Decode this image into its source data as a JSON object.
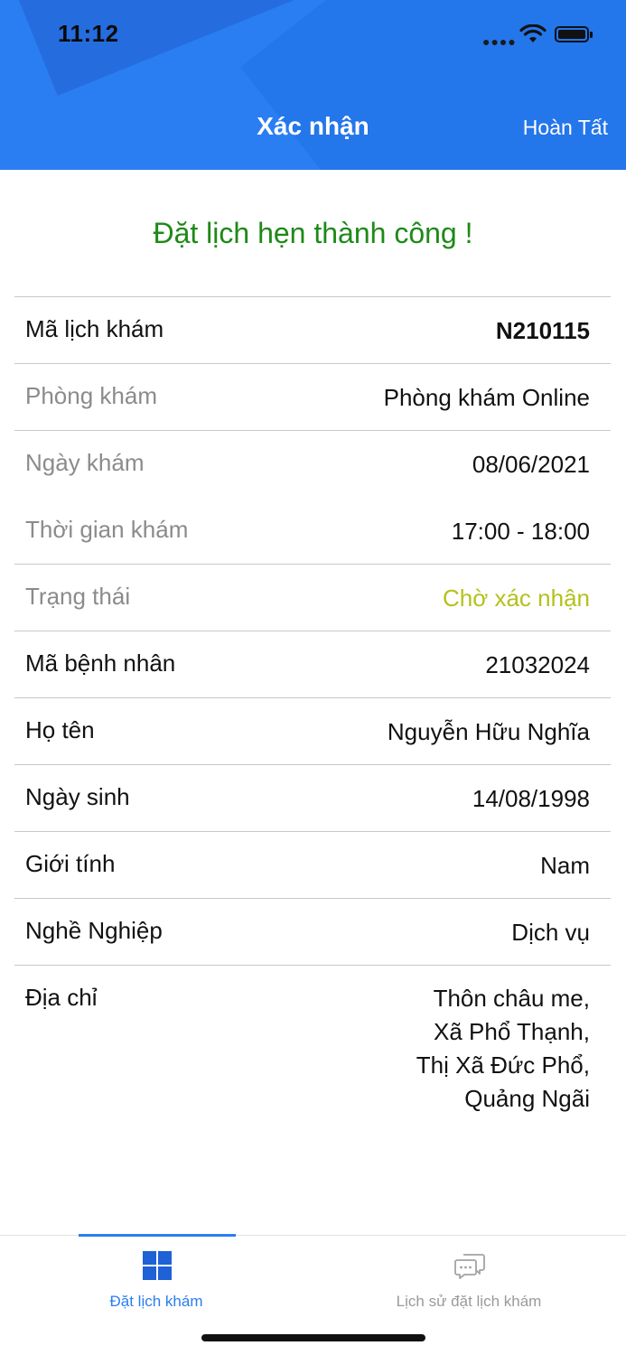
{
  "status_bar": {
    "time": "11:12",
    "icons": [
      "signal-dots-icon",
      "wifi-icon",
      "battery-icon"
    ]
  },
  "nav": {
    "title": "Xác nhận",
    "done_label": "Hoàn Tất",
    "background_color": "#2a7ef2"
  },
  "success_message": {
    "text": "Đặt lịch hẹn thành công !",
    "color": "#1e8a17"
  },
  "details": {
    "appointment_code": {
      "label": "Mã lịch khám",
      "value": "N210115"
    },
    "clinic": {
      "label": "Phòng khám",
      "value": "Phòng khám Online"
    },
    "date": {
      "label": "Ngày khám",
      "value": "08/06/2021"
    },
    "time": {
      "label": "Thời gian khám",
      "value": "17:00 - 18:00"
    },
    "status": {
      "label": "Trạng thái",
      "value": "Chờ xác nhận",
      "color": "#b5c11b"
    },
    "patient_code": {
      "label": "Mã bệnh nhân",
      "value": "21032024"
    },
    "full_name": {
      "label": "Họ tên",
      "value": "Nguyễn Hữu Nghĩa"
    },
    "birth_date": {
      "label": "Ngày sinh",
      "value": "14/08/1998"
    },
    "gender": {
      "label": "Giới tính",
      "value": "Nam"
    },
    "occupation": {
      "label": "Nghề Nghiệp",
      "value": "Dịch vụ"
    },
    "address": {
      "label": "Địa chỉ",
      "value": "Thôn châu me,\nXã Phổ Thạnh,\nThị Xã Đức Phổ,\nQuảng Ngãi"
    }
  },
  "tabbar": {
    "tabs": [
      {
        "label": "Đặt lịch khám",
        "icon": "grid-icon",
        "active": true
      },
      {
        "label": "Lịch sử đặt lịch khám",
        "icon": "chat-bubbles-icon",
        "active": false
      }
    ],
    "accent_color": "#2a7ef2"
  }
}
